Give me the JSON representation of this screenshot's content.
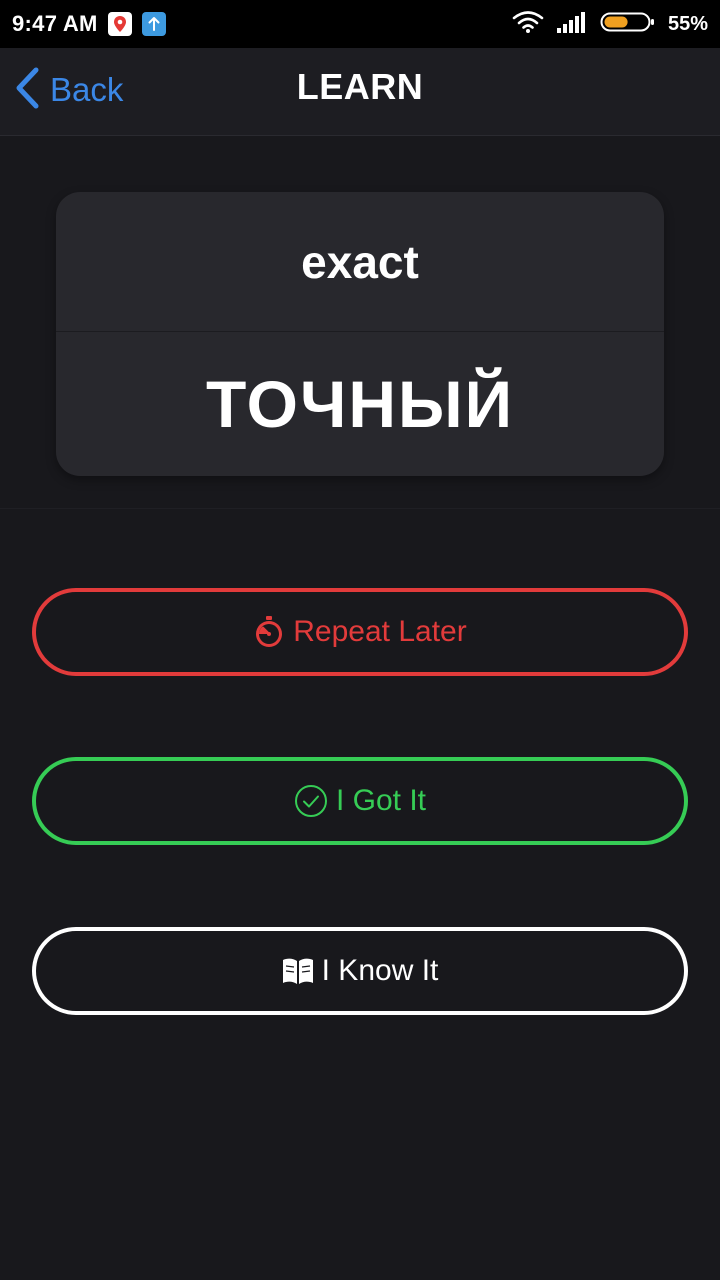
{
  "status_bar": {
    "time": "9:47 AM",
    "battery_percent": "55%",
    "battery_level": 0.55,
    "battery_color": "#f0a020",
    "icons": [
      "map-pin-icon",
      "upload-icon",
      "wifi-icon",
      "signal-icon",
      "battery-icon"
    ]
  },
  "nav": {
    "back_label": "Back",
    "title": "LEARN",
    "accent_color": "#3b87e6"
  },
  "card": {
    "word": "exact",
    "translation": "ТОЧНЫЙ"
  },
  "actions": {
    "repeat_label": "Repeat Later",
    "repeat_icon": "stopwatch-icon",
    "repeat_color": "#e23b3b",
    "got_label": "I Got It",
    "got_icon": "check-circle-icon",
    "got_color": "#36cc55",
    "know_label": "I Know It",
    "know_icon": "book-icon",
    "know_color": "#ffffff"
  }
}
